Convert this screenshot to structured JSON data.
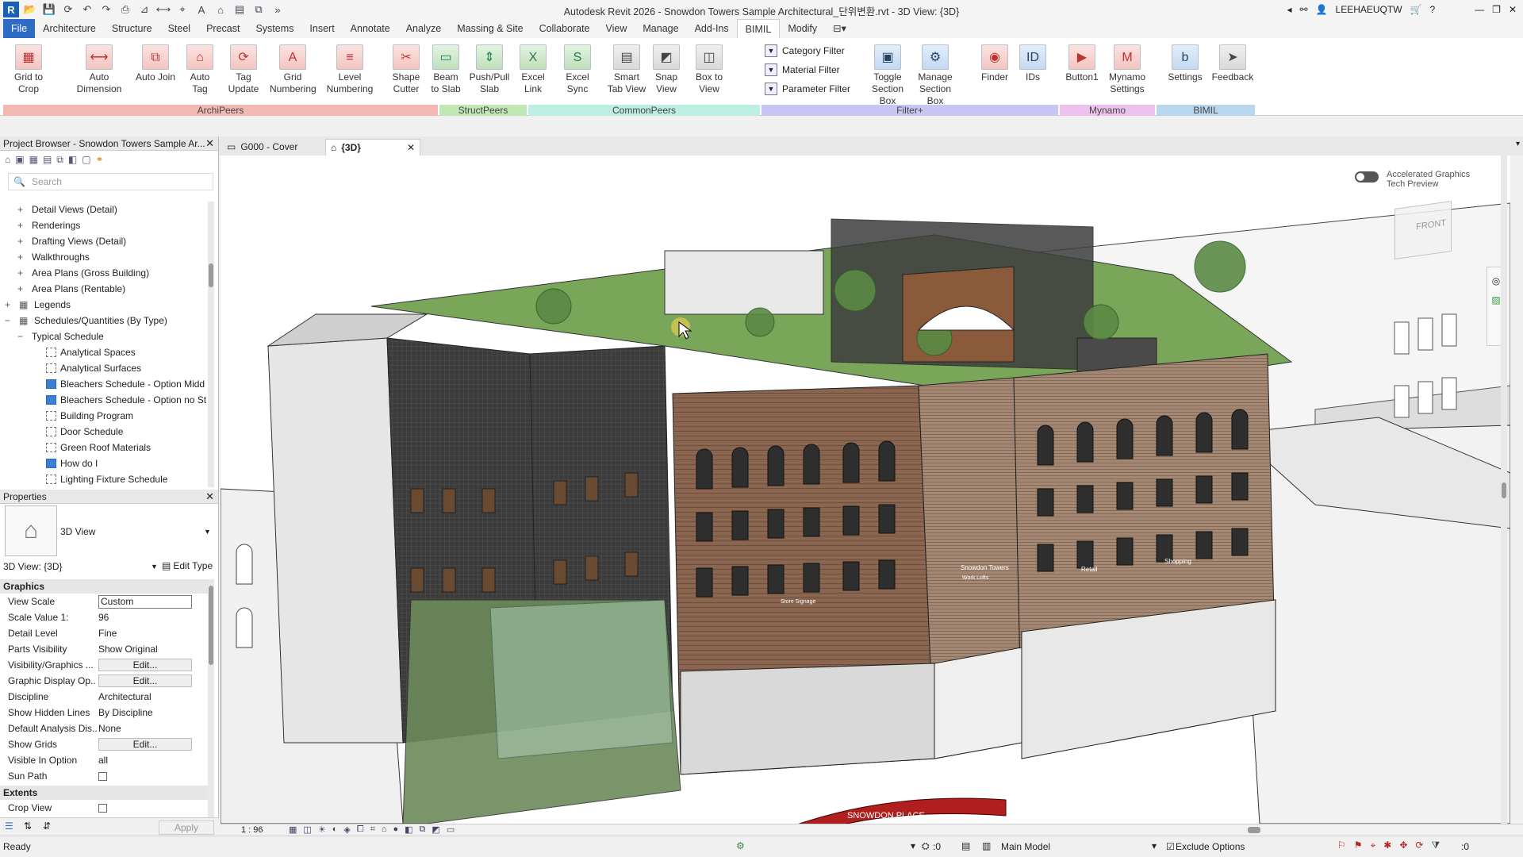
{
  "app": {
    "title": "Autodesk Revit 2026 - Snowdon Towers Sample Architectural_단위변환.rvt - 3D View: {3D}",
    "user": "LEEHAEUQTW",
    "logo_letter": "R"
  },
  "menu": [
    "File",
    "Architecture",
    "Structure",
    "Steel",
    "Precast",
    "Systems",
    "Insert",
    "Annotate",
    "Analyze",
    "Massing & Site",
    "Collaborate",
    "View",
    "Manage",
    "Add-Ins",
    "BIMIL",
    "Modify"
  ],
  "active_menu": "BIMIL",
  "ribbon": {
    "buttons": [
      {
        "label1": "Grid to",
        "label2": "Crop",
        "icon": "grid-crop-icon",
        "glyph": "▦",
        "style": ""
      },
      {
        "label1": "Auto",
        "label2": "Dimension",
        "icon": "dimension-icon",
        "glyph": "⟷",
        "style": ""
      },
      {
        "label1": "Auto Join",
        "label2": "",
        "icon": "join-icon",
        "glyph": "⧉",
        "style": ""
      },
      {
        "label1": "Auto",
        "label2": "Tag",
        "icon": "tag-icon",
        "glyph": "⌂",
        "style": ""
      },
      {
        "label1": "Tag",
        "label2": "Update",
        "icon": "tag-update-icon",
        "glyph": "⟳",
        "style": ""
      },
      {
        "label1": "Grid",
        "label2": "Numbering",
        "icon": "grid-numbering-icon",
        "glyph": "A",
        "style": ""
      },
      {
        "label1": "Level",
        "label2": "Numbering",
        "icon": "level-numbering-icon",
        "glyph": "≡",
        "style": ""
      },
      {
        "label1": "Shape",
        "label2": "Cutter",
        "icon": "shape-cutter-icon",
        "glyph": "✂",
        "style": ""
      },
      {
        "label1": "Beam",
        "label2": "to Slab",
        "icon": "beam-slab-icon",
        "glyph": "▭",
        "style": "green"
      },
      {
        "label1": "Push/Pull",
        "label2": "Slab",
        "icon": "push-pull-icon",
        "glyph": "⇕",
        "style": "green"
      },
      {
        "label1": "Excel Link",
        "label2": "",
        "icon": "excel-link-icon",
        "glyph": "X",
        "style": "green"
      },
      {
        "label1": "Excel Sync",
        "label2": "",
        "icon": "excel-sync-icon",
        "glyph": "S",
        "style": "green"
      },
      {
        "label1": "Smart",
        "label2": "Tab View",
        "icon": "smart-tab-icon",
        "glyph": "▤",
        "style": "gray"
      },
      {
        "label1": "Snap",
        "label2": "View",
        "icon": "snap-view-icon",
        "glyph": "◩",
        "style": "gray"
      },
      {
        "label1": "Box to",
        "label2": "View",
        "icon": "box-view-icon",
        "glyph": "◫",
        "style": "gray"
      },
      {
        "label1": "Toggle",
        "label2": "Section Box",
        "icon": "section-box-icon",
        "glyph": "▣",
        "style": "blue"
      },
      {
        "label1": "Manage",
        "label2": "Section Box",
        "icon": "manage-section-icon",
        "glyph": "⚙",
        "style": "blue"
      },
      {
        "label1": "Finder",
        "label2": "",
        "icon": "finder-icon",
        "glyph": "◉",
        "style": ""
      },
      {
        "label1": "IDs",
        "label2": "",
        "icon": "ids-icon",
        "glyph": "ID",
        "style": "blue"
      },
      {
        "label1": "Button1",
        "label2": "",
        "icon": "button1-icon",
        "glyph": "▶",
        "style": ""
      },
      {
        "label1": "Mynamo",
        "label2": "Settings",
        "icon": "mynamo-icon",
        "glyph": "M",
        "style": ""
      },
      {
        "label1": "Settings",
        "label2": "",
        "icon": "settings-icon",
        "glyph": "b",
        "style": "blue"
      },
      {
        "label1": "Feedback",
        "label2": "",
        "icon": "feedback-icon",
        "glyph": "➤",
        "style": "gray"
      }
    ],
    "filters": [
      "Category Filter",
      "Material Filter",
      "Parameter Filter"
    ],
    "panels": [
      {
        "name": "ArchiPeers",
        "color": "#f4b8b3"
      },
      {
        "name": "StructPeers",
        "color": "#bfe8b4"
      },
      {
        "name": "CommonPeers",
        "color": "#bdeee4"
      },
      {
        "name": "Filter+",
        "color": "#c9c6f3"
      },
      {
        "name": "Mynamo",
        "color": "#eec2ee"
      },
      {
        "name": "BIMIL",
        "color": "#b8d7ef"
      }
    ]
  },
  "project_browser": {
    "title": "Project Browser - Snowdon Towers Sample Ar...",
    "search_placeholder": "Search",
    "items": [
      {
        "label": "Detail Views (Detail)",
        "level": 1,
        "kind": "plus"
      },
      {
        "label": "Renderings",
        "level": 1,
        "kind": "plus"
      },
      {
        "label": "Drafting Views (Detail)",
        "level": 1,
        "kind": "plus"
      },
      {
        "label": "Walkthroughs",
        "level": 1,
        "kind": "plus"
      },
      {
        "label": "Area Plans (Gross Building)",
        "level": 1,
        "kind": "plus"
      },
      {
        "label": "Area Plans (Rentable)",
        "level": 1,
        "kind": "plus"
      },
      {
        "label": "Legends",
        "level": 0,
        "kind": "plus"
      },
      {
        "label": "Schedules/Quantities (By Type)",
        "level": 0,
        "kind": "minus"
      },
      {
        "label": "Typical Schedule",
        "level": 1,
        "kind": "minus"
      },
      {
        "label": "Analytical Spaces",
        "level": 2,
        "kind": "dash"
      },
      {
        "label": "Analytical Surfaces",
        "level": 2,
        "kind": "dash"
      },
      {
        "label": "Bleachers Schedule - Option Midd",
        "level": 2,
        "kind": "solid"
      },
      {
        "label": "Bleachers Schedule - Option no St",
        "level": 2,
        "kind": "solid"
      },
      {
        "label": "Building Program",
        "level": 2,
        "kind": "dash"
      },
      {
        "label": "Door Schedule",
        "level": 2,
        "kind": "dash"
      },
      {
        "label": "Green Roof Materials",
        "level": 2,
        "kind": "dash"
      },
      {
        "label": "How do I",
        "level": 2,
        "kind": "solid"
      },
      {
        "label": "Lighting Fixture Schedule",
        "level": 2,
        "kind": "dash"
      }
    ]
  },
  "properties": {
    "title": "Properties",
    "type_name": "3D View",
    "selector": "3D View: {3D}",
    "edit_type": "Edit Type",
    "sections": {
      "graphics": "Graphics",
      "extents": "Extents"
    },
    "rows": [
      {
        "k": "View Scale",
        "v": "Custom",
        "kind": "input"
      },
      {
        "k": "Scale Value    1:",
        "v": "96",
        "kind": "text"
      },
      {
        "k": "Detail Level",
        "v": "Fine",
        "kind": "text"
      },
      {
        "k": "Parts Visibility",
        "v": "Show Original",
        "kind": "text"
      },
      {
        "k": "Visibility/Graphics ...",
        "v": "Edit...",
        "kind": "button"
      },
      {
        "k": "Graphic Display Op...",
        "v": "Edit...",
        "kind": "button"
      },
      {
        "k": "Discipline",
        "v": "Architectural",
        "kind": "text"
      },
      {
        "k": "Show Hidden Lines",
        "v": "By Discipline",
        "kind": "text"
      },
      {
        "k": "Default Analysis Dis...",
        "v": "None",
        "kind": "text"
      },
      {
        "k": "Show Grids",
        "v": "Edit...",
        "kind": "button"
      },
      {
        "k": "Visible In Option",
        "v": "all",
        "kind": "text"
      },
      {
        "k": "Sun Path",
        "v": "",
        "kind": "check"
      }
    ],
    "extent_rows": [
      {
        "k": "Crop View",
        "v": "",
        "kind": "check"
      }
    ],
    "apply": "Apply"
  },
  "view_tabs": [
    {
      "label": "G000 - Cover",
      "active": false
    },
    {
      "label": "{3D}",
      "active": true
    }
  ],
  "canvas": {
    "accelerated": "Accelerated Graphics",
    "tech_preview": "Tech Preview",
    "viewcube": "FRONT",
    "signs": {
      "s1": "Snowdon Towers",
      "s2": "Work Lofts",
      "s3": "Retail",
      "s4": "Shopping",
      "s5": "Store Signage",
      "s6": "SNOWDON PLACE"
    }
  },
  "view_bar": {
    "scale": "1 : 96"
  },
  "status": {
    "ready": "Ready",
    "workset_count": ":0",
    "model": "Main Model",
    "exclude": "Exclude Options",
    "filter_count": ":0"
  }
}
